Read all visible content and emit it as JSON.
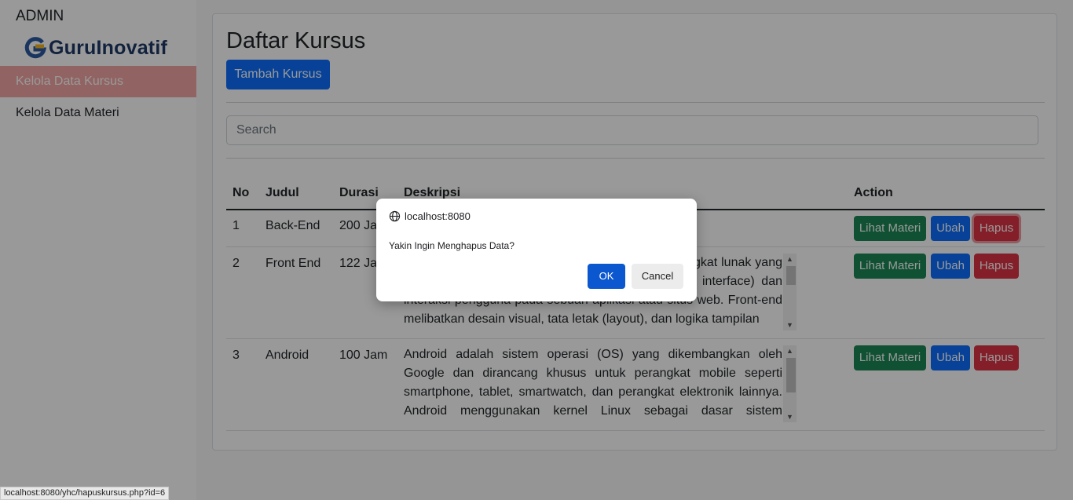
{
  "sidebar": {
    "admin_label": "ADMIN",
    "logo_text": "GuruInovatif",
    "items": [
      {
        "label": "Kelola Data Kursus",
        "active": true
      },
      {
        "label": "Kelola Data Materi",
        "active": false
      }
    ]
  },
  "main": {
    "title": "Daftar Kursus",
    "add_button": "Tambah Kursus",
    "search_placeholder": "Search",
    "table": {
      "headers": [
        "No",
        "Judul",
        "Durasi",
        "Deskripsi",
        "Action"
      ],
      "rows": [
        {
          "no": "1",
          "judul": "Back-End",
          "durasi": "200 Jam",
          "deskripsi": "",
          "actions": [
            "Lihat Materi",
            "Ubah",
            "Hapus"
          ]
        },
        {
          "no": "2",
          "judul": "Front End",
          "durasi": "122 Jam",
          "deskripsi": "Front-end adalah bagian dari pengembangan perangkat lunak yang berfokus pada bagian antarmuka pengguna (user interface) dan interaksi pengguna pada sebuah aplikasi atau situs web. Front-end melibatkan desain visual, tata letak (layout), dan logika tampilan",
          "actions": [
            "Lihat Materi",
            "Ubah",
            "Hapus"
          ]
        },
        {
          "no": "3",
          "judul": "Android",
          "durasi": "100 Jam",
          "deskripsi": "Android adalah sistem operasi (OS) yang dikembangkan oleh Google dan dirancang khusus untuk perangkat mobile seperti smartphone, tablet, smartwatch, dan perangkat elektronik lainnya. Android menggunakan kernel Linux sebagai dasar sistem operasinya",
          "actions": [
            "Lihat Materi",
            "Ubah",
            "Hapus"
          ]
        }
      ]
    }
  },
  "dialog": {
    "origin": "localhost:8080",
    "message": "Yakin Ingin Menghapus Data?",
    "ok_label": "OK",
    "cancel_label": "Cancel"
  },
  "statusbar": {
    "url": "localhost:8080/yhc/hapuskursus.php?id=6"
  },
  "colors": {
    "primary": "#0d6efd",
    "success": "#198754",
    "danger": "#dc3545",
    "active_nav": "#f4a6a6",
    "dialog_ok": "#0b57d0"
  }
}
